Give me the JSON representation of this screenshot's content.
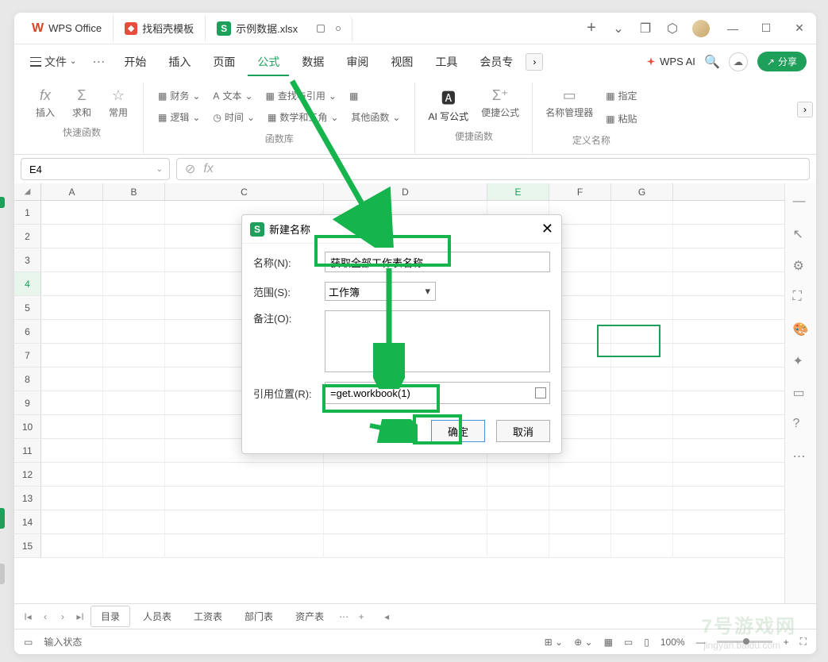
{
  "titlebar": {
    "app_name": "WPS Office",
    "template_tab": "找稻壳模板",
    "doc_tab": "示例数据.xlsx"
  },
  "menubar": {
    "file": "文件",
    "items": [
      "开始",
      "插入",
      "页面",
      "公式",
      "数据",
      "审阅",
      "视图",
      "工具",
      "会员专"
    ],
    "ai": "WPS AI",
    "share": "分享"
  },
  "ribbon": {
    "group1": {
      "fx": "插入",
      "sum": "求和",
      "star": "常用",
      "label": "快速函数"
    },
    "group2": {
      "financial": "财务",
      "text": "文本",
      "lookup": "查找与引用",
      "logic": "逻辑",
      "time": "时间",
      "math": "数学和三角",
      "other": "其他函数",
      "label": "函数库"
    },
    "group3": {
      "ai": "AI 写公式",
      "quick": "便捷公式",
      "label": "便捷函数"
    },
    "group4": {
      "name_mgr": "名称管理器",
      "paste": "粘贴",
      "define": "指定",
      "label": "定义名称"
    }
  },
  "cell_ref": "E4",
  "columns": [
    "A",
    "B",
    "C",
    "D",
    "E",
    "F",
    "G"
  ],
  "rows": [
    "1",
    "2",
    "3",
    "4",
    "5",
    "6",
    "7",
    "8",
    "9",
    "10",
    "11",
    "12",
    "13",
    "14",
    "15"
  ],
  "dialog": {
    "title": "新建名称",
    "name_label": "名称(N):",
    "name_value": "获取全部工作表名称",
    "scope_label": "范围(S):",
    "scope_value": "工作簿",
    "comment_label": "备注(O):",
    "ref_label": "引用位置(R):",
    "ref_value": "=get.workbook(1)",
    "ok": "确定",
    "cancel": "取消"
  },
  "sheets": {
    "active": "目录",
    "others": [
      "人员表",
      "工资表",
      "部门表",
      "资产表"
    ]
  },
  "statusbar": {
    "status": "输入状态",
    "zoom": "100%"
  }
}
